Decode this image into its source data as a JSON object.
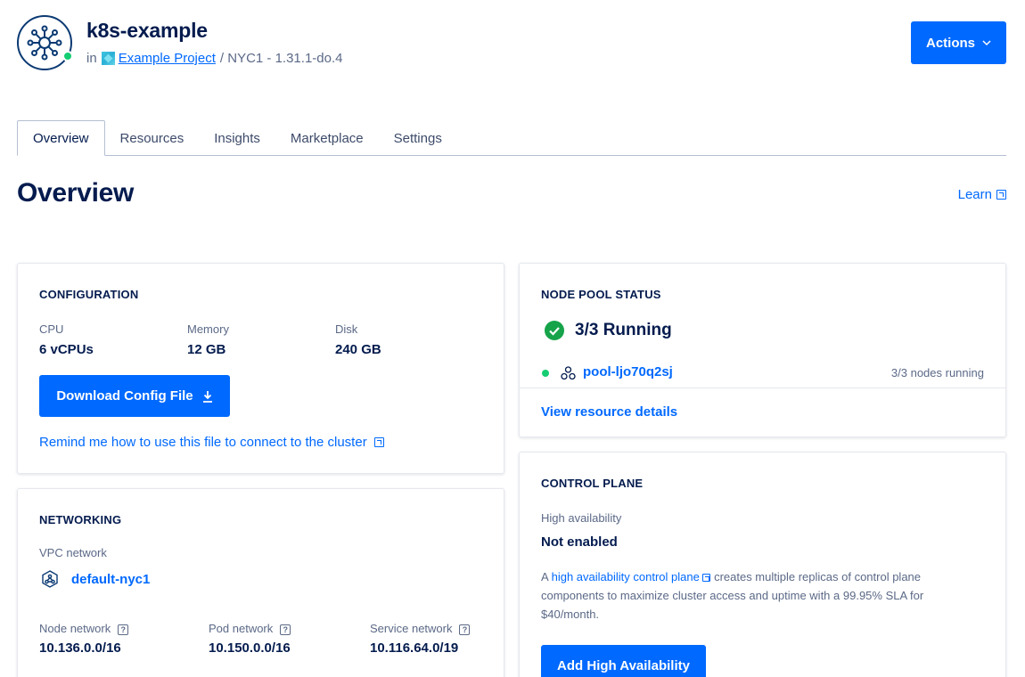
{
  "header": {
    "cluster_name": "k8s-example",
    "in_label": "in",
    "project_name": "Example Project",
    "region_version": "/ NYC1 - 1.31.1-do.4",
    "actions_label": "Actions"
  },
  "tabs": [
    {
      "label": "Overview",
      "active": true
    },
    {
      "label": "Resources",
      "active": false
    },
    {
      "label": "Insights",
      "active": false
    },
    {
      "label": "Marketplace",
      "active": false
    },
    {
      "label": "Settings",
      "active": false
    }
  ],
  "page": {
    "title": "Overview",
    "learn_label": "Learn"
  },
  "configuration": {
    "title": "CONFIGURATION",
    "cpu_label": "CPU",
    "cpu_value": "6 vCPUs",
    "memory_label": "Memory",
    "memory_value": "12 GB",
    "disk_label": "Disk",
    "disk_value": "240 GB",
    "download_label": "Download Config File",
    "remind_link": "Remind me how to use this file to connect to the cluster"
  },
  "node_pool": {
    "title": "NODE POOL STATUS",
    "running_summary": "3/3 Running",
    "pool_name": "pool-ljo70q2sj",
    "pool_status": "3/3 nodes running",
    "view_details": "View resource details"
  },
  "networking": {
    "title": "NETWORKING",
    "vpc_label": "VPC network",
    "vpc_name": "default-nyc1",
    "node_network_label": "Node network",
    "node_network_value": "10.136.0.0/16",
    "pod_network_label": "Pod network",
    "pod_network_value": "10.150.0.0/16",
    "service_network_label": "Service network",
    "service_network_value": "10.116.64.0/19",
    "help_glyph": "?"
  },
  "control_plane": {
    "title": "CONTROL PLANE",
    "ha_label": "High availability",
    "ha_value": "Not enabled",
    "desc_prefix": "A",
    "desc_link": "high availability control plane",
    "desc_suffix": "creates multiple replicas of control plane components to maximize cluster access and uptime with a 99.95% SLA for $40/month.",
    "add_ha_label": "Add High Availability"
  },
  "colors": {
    "primary": "#0069ff",
    "heading": "#031b4e",
    "muted": "#5b6987",
    "success": "#15cd72",
    "success_check": "#16a34a"
  }
}
